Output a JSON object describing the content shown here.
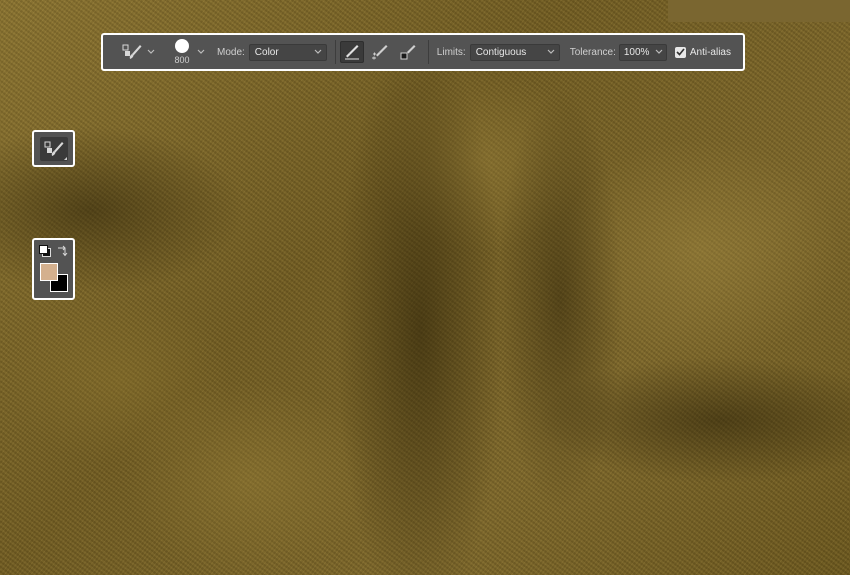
{
  "options_bar": {
    "brush_size": "800",
    "mode_label": "Mode:",
    "mode_value": "Color",
    "limits_label": "Limits:",
    "limits_value": "Contiguous",
    "tolerance_label": "Tolerance:",
    "tolerance_value": "100%",
    "anti_alias_label": "Anti-alias",
    "anti_alias_checked": true,
    "icons": {
      "tool": "color-replacement-tool-icon",
      "sampling_continuous": "sampling-continuous-icon",
      "sampling_once": "sampling-once-icon",
      "sampling_background": "sampling-background-swatch-icon"
    }
  },
  "tools_panel": {
    "active_tool_icon": "color-replacement-tool-icon"
  },
  "color_panel": {
    "foreground_color": "#d4b08e",
    "background_color": "#000000"
  },
  "colors": {
    "ui_panel": "#535353",
    "ui_border": "#ffffff",
    "canvas_base": "#7a6526"
  }
}
